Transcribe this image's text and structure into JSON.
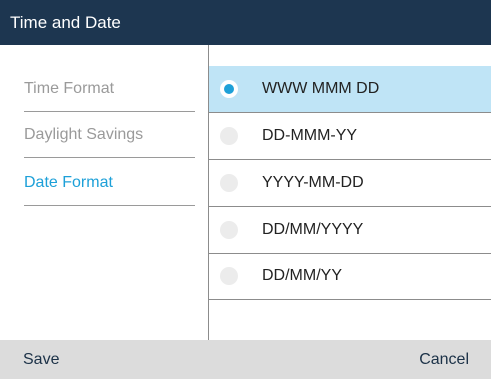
{
  "header": {
    "title": "Time and Date"
  },
  "menu": {
    "items": [
      {
        "label": "Time Format",
        "active": false
      },
      {
        "label": "Daylight Savings",
        "active": false
      },
      {
        "label": "Date Format",
        "active": true
      }
    ]
  },
  "date_format": {
    "selected": "WWW MMM DD",
    "options": [
      {
        "label": "WWW MMM DD",
        "selected": true
      },
      {
        "label": "DD-MMM-YY",
        "selected": false
      },
      {
        "label": "YYYY-MM-DD",
        "selected": false
      },
      {
        "label": "DD/MM/YYYY",
        "selected": false
      },
      {
        "label": "DD/MM/YY",
        "selected": false
      }
    ]
  },
  "softkeys": {
    "left_label": "Save",
    "right_label": "Cancel"
  },
  "colors": {
    "titlebar": "#1d3650",
    "accent": "#1da0d8",
    "selected_row": "#bfe4f6",
    "softkey_bar": "#dcdcdc"
  }
}
